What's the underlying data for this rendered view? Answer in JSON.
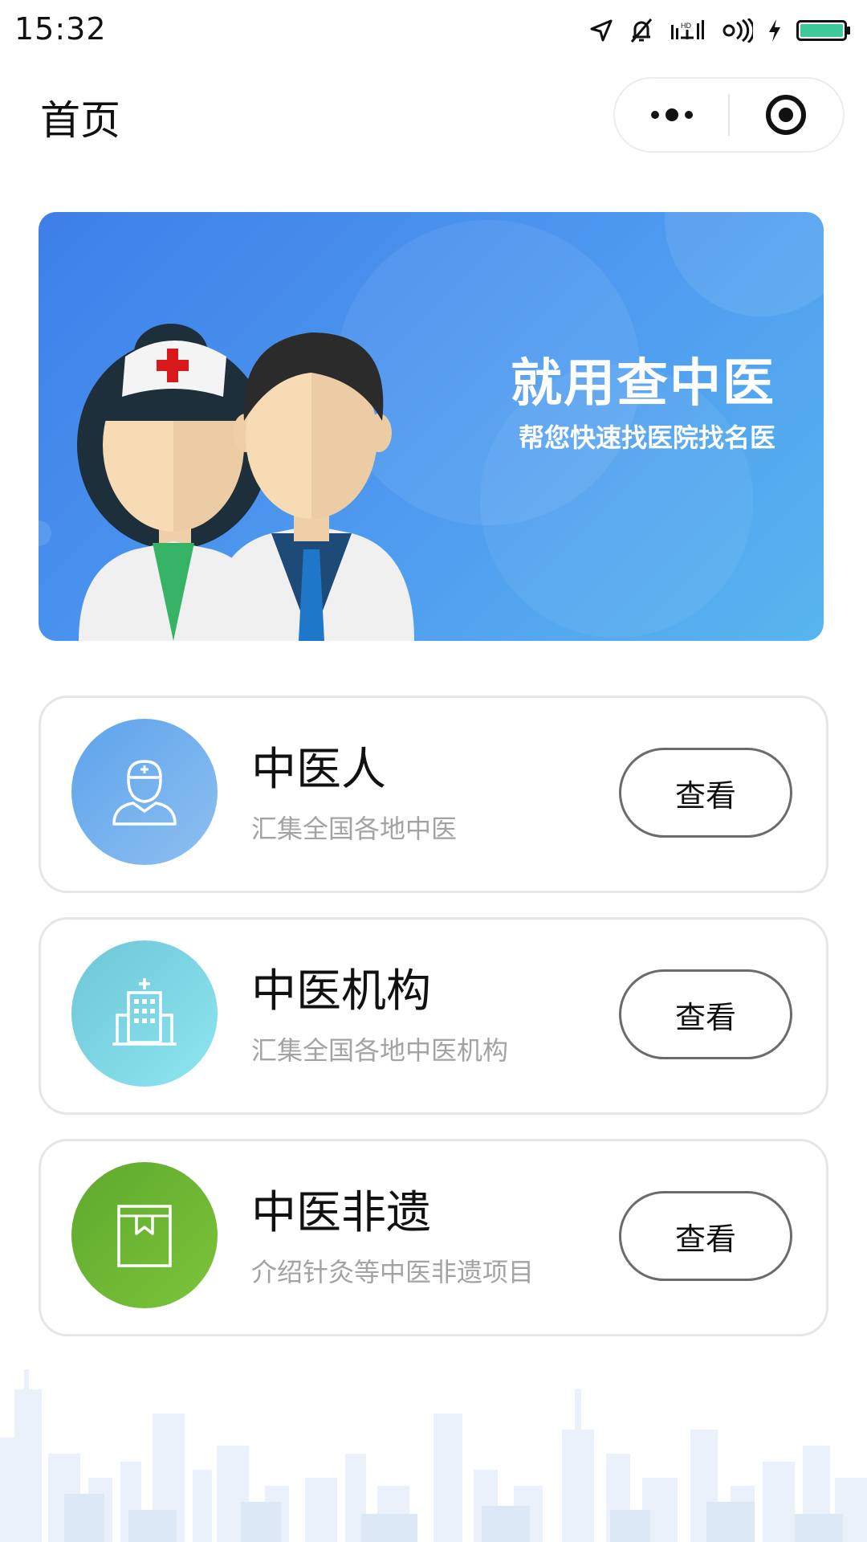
{
  "status_bar": {
    "time": "15:32",
    "icons": [
      "location-arrow-icon",
      "bell-off-icon",
      "signal-icon",
      "wifi-icon",
      "charging-icon",
      "battery-icon"
    ],
    "battery_color": "#3ec99a"
  },
  "nav": {
    "title": "首页",
    "more_icon": "more-dots-icon",
    "close_icon": "target-circle-icon"
  },
  "banner": {
    "title": "就用查中医",
    "subtitle": "帮您快速找医院找名医",
    "colors": [
      "#3d7fe8",
      "#58b5ee"
    ]
  },
  "cards": [
    {
      "title": "中医人",
      "desc": "汇集全国各地中医",
      "button": "查看",
      "icon": "doctor-icon",
      "colors": [
        "#5da3ec",
        "#8ec0f0"
      ]
    },
    {
      "title": "中医机构",
      "desc": "汇集全国各地中医机构",
      "button": "查看",
      "icon": "hospital-icon",
      "colors": [
        "#6ec6d6",
        "#8ee6f2"
      ]
    },
    {
      "title": "中医非遗",
      "desc": "介绍针灸等中医非遗项目",
      "button": "查看",
      "icon": "book-icon",
      "colors": [
        "#5ea92e",
        "#7cc43a"
      ]
    }
  ]
}
